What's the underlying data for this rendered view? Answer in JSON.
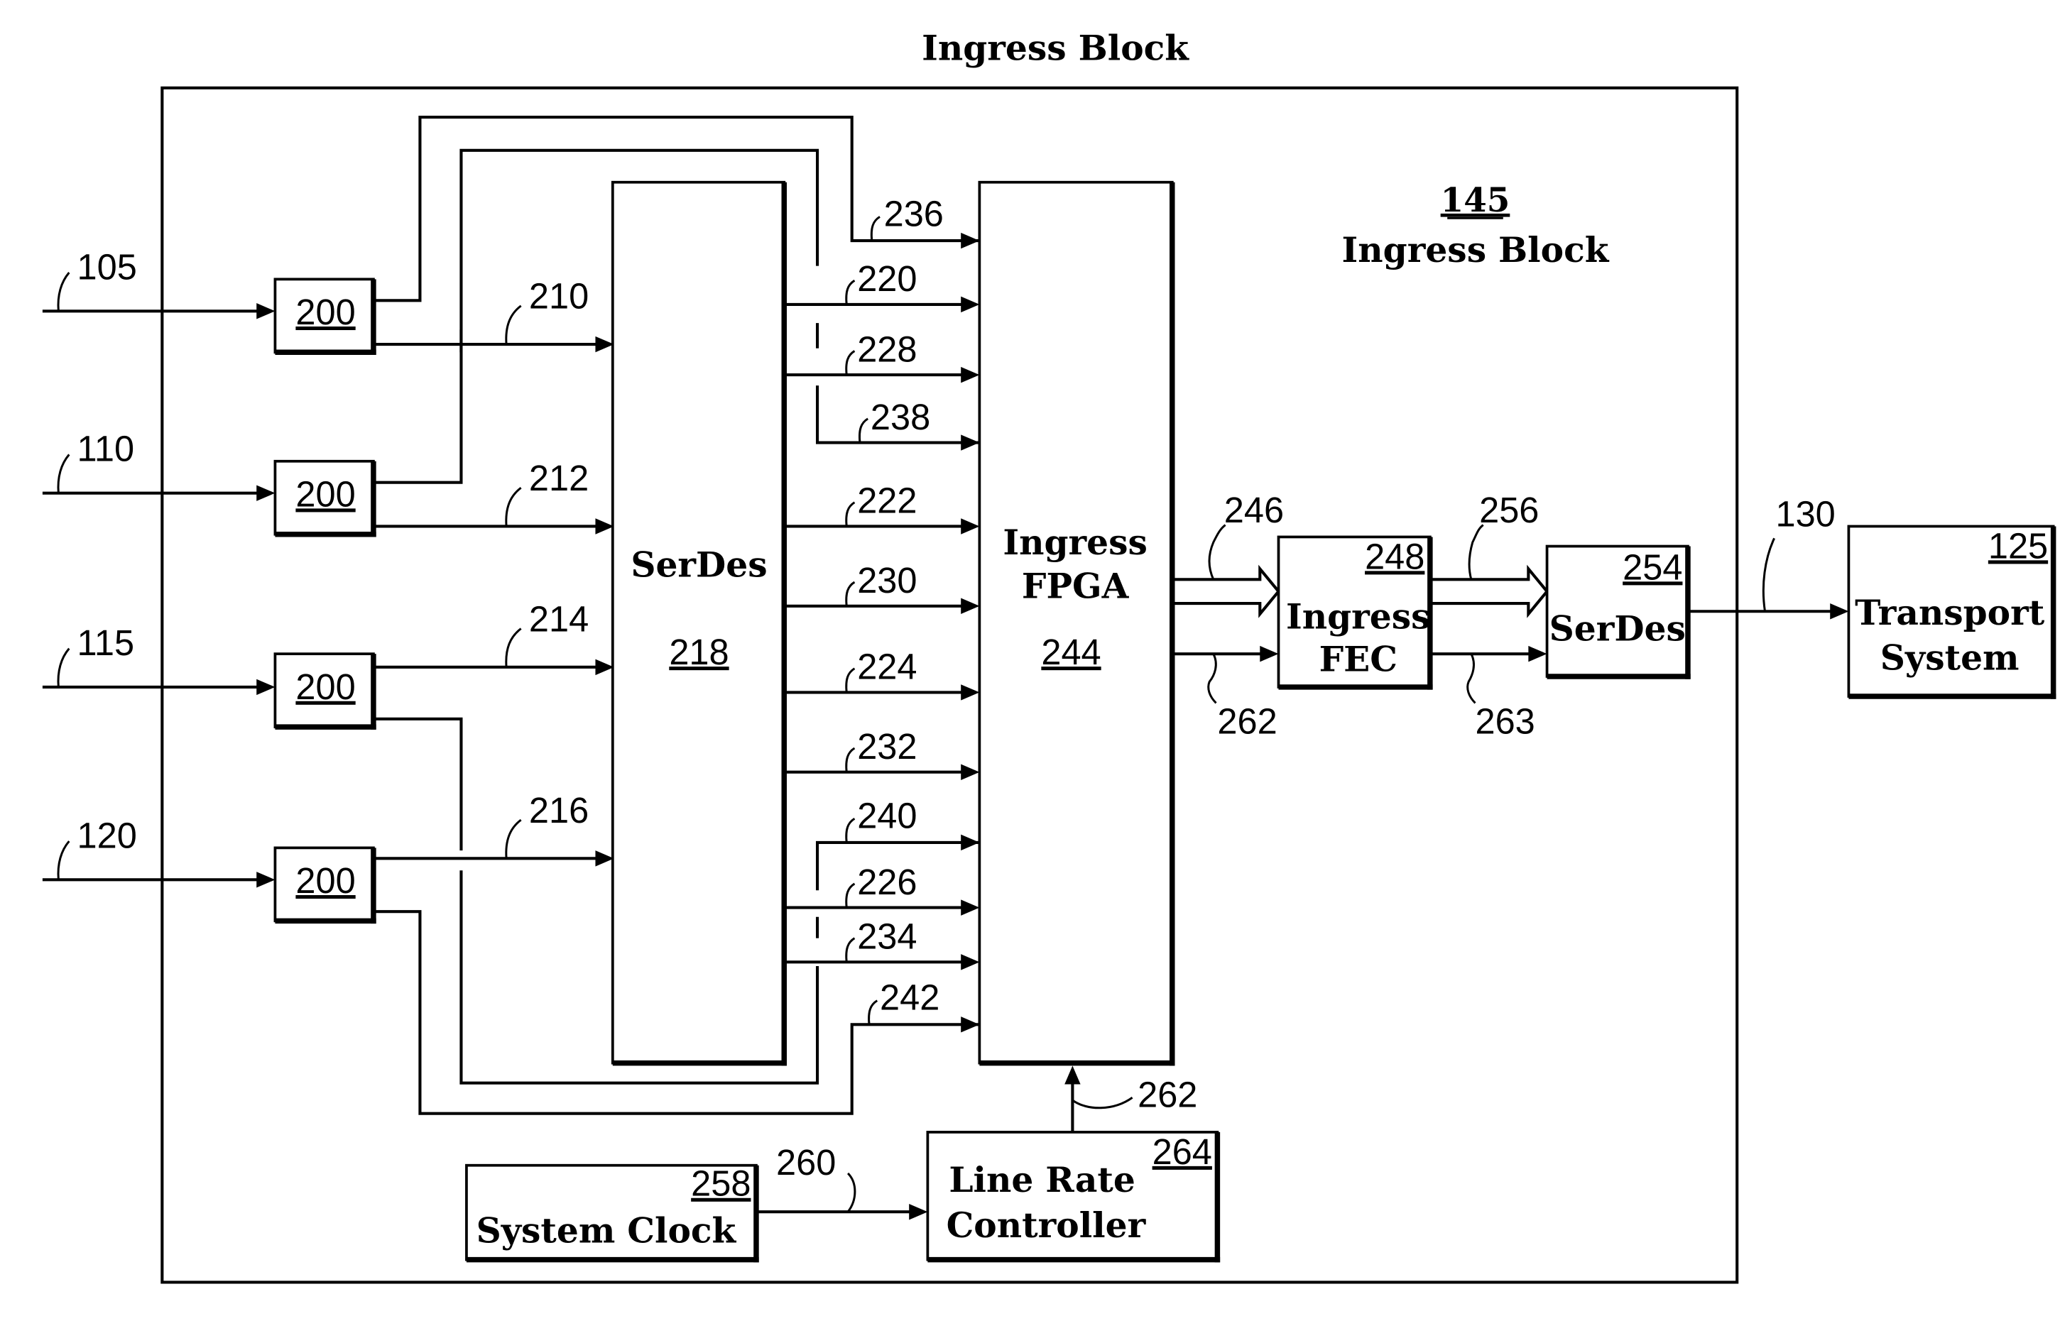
{
  "title": "Ingress Block",
  "outer_block": {
    "ref": "145",
    "label": "Ingress Block"
  },
  "inputs": [
    {
      "ref": "105"
    },
    {
      "ref": "110"
    },
    {
      "ref": "115"
    },
    {
      "ref": "120"
    }
  ],
  "input_modules": [
    {
      "ref": "200"
    },
    {
      "ref": "200"
    },
    {
      "ref": "200"
    },
    {
      "ref": "200"
    }
  ],
  "module_to_serdes": [
    {
      "ref": "210"
    },
    {
      "ref": "212"
    },
    {
      "ref": "214"
    },
    {
      "ref": "216"
    }
  ],
  "serdes_218": {
    "label": "SerDes",
    "ref": "218"
  },
  "fpga_244": {
    "label_line1": "Ingress",
    "label_line2": "FPGA",
    "ref": "244"
  },
  "fpga_inputs": [
    {
      "ref": "236"
    },
    {
      "ref": "220"
    },
    {
      "ref": "228"
    },
    {
      "ref": "238"
    },
    {
      "ref": "222"
    },
    {
      "ref": "230"
    },
    {
      "ref": "224"
    },
    {
      "ref": "232"
    },
    {
      "ref": "240"
    },
    {
      "ref": "226"
    },
    {
      "ref": "234"
    },
    {
      "ref": "242"
    }
  ],
  "fpga_to_fec": {
    "bus_ref": "246",
    "ctrl_ref": "262"
  },
  "fec_248": {
    "label_line1": "Ingress",
    "label_line2": "FEC",
    "ref": "248"
  },
  "fec_to_serdes": {
    "bus_ref": "256",
    "ctrl_ref": "263"
  },
  "serdes_254": {
    "label": "SerDes",
    "ref": "254"
  },
  "output_link": {
    "ref": "130"
  },
  "transport_125": {
    "label_line1": "Transport",
    "label_line2": "System",
    "ref": "125"
  },
  "system_clock_258": {
    "label": "System Clock",
    "ref": "258"
  },
  "clock_link": {
    "ref": "260"
  },
  "line_rate_264": {
    "label_line1": "Line Rate",
    "label_line2": "Controller",
    "ref": "264"
  },
  "rate_ctrl_link": {
    "ref": "262"
  }
}
